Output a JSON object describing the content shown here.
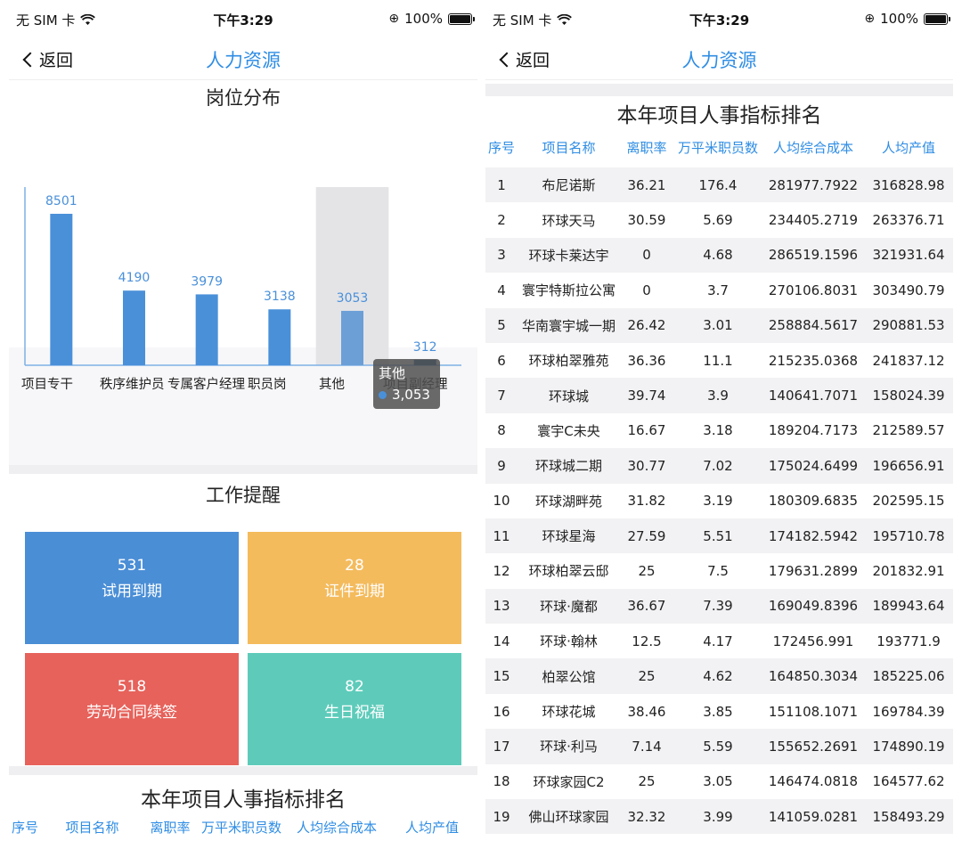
{
  "status_bar": {
    "carrier": "无 SIM 卡",
    "time": "下午3:29",
    "battery": "100%"
  },
  "nav": {
    "back_label": "返回",
    "title": "人力资源"
  },
  "chart_data": {
    "type": "bar",
    "title": "岗位分布",
    "categories": [
      "项目专干",
      "秩序维护员",
      "专属客户经理",
      "职员岗",
      "其他",
      "项目副经理"
    ],
    "values": [
      8501,
      4190,
      3979,
      3138,
      3053,
      312
    ],
    "highlighted_category": "其他",
    "tooltip": {
      "category": "其他",
      "value": "3,053"
    },
    "color": "#4a90d9",
    "highlight_color": "#e4e4e7"
  },
  "reminders": {
    "title": "工作提醒",
    "items": [
      {
        "count": "531",
        "label": "试用到期",
        "color": "#4a8ed6"
      },
      {
        "count": "28",
        "label": "证件到期",
        "color": "#f4bb5d"
      },
      {
        "count": "518",
        "label": "劳动合同续签",
        "color": "#e6625b"
      },
      {
        "count": "82",
        "label": "生日祝福",
        "color": "#5ecbba"
      }
    ]
  },
  "ranking": {
    "title": "本年项目人事指标排名",
    "headers": [
      "序号",
      "项目名称",
      "离职率",
      "万平米职员数",
      "人均综合成本",
      "人均产值"
    ],
    "rows": [
      [
        "1",
        "布尼诺斯",
        "36.21",
        "176.4",
        "281977.7922",
        "316828.98"
      ],
      [
        "2",
        "环球天马",
        "30.59",
        "5.69",
        "234405.2719",
        "263376.71"
      ],
      [
        "3",
        "环球卡莱达宇",
        "0",
        "4.68",
        "286519.1596",
        "321931.64"
      ],
      [
        "4",
        "寰宇特斯拉公寓",
        "0",
        "3.7",
        "270106.8031",
        "303490.79"
      ],
      [
        "5",
        "华南寰宇城一期",
        "26.42",
        "3.01",
        "258884.5617",
        "290881.53"
      ],
      [
        "6",
        "环球柏翠雅苑",
        "36.36",
        "11.1",
        "215235.0368",
        "241837.12"
      ],
      [
        "7",
        "环球城",
        "39.74",
        "3.9",
        "140641.7071",
        "158024.39"
      ],
      [
        "8",
        "寰宇C未央",
        "16.67",
        "3.18",
        "189204.7173",
        "212589.57"
      ],
      [
        "9",
        "环球城二期",
        "30.77",
        "7.02",
        "175024.6499",
        "196656.91"
      ],
      [
        "10",
        "环球湖畔苑",
        "31.82",
        "3.19",
        "180309.6835",
        "202595.15"
      ],
      [
        "11",
        "环球星海",
        "27.59",
        "5.51",
        "174182.5942",
        "195710.78"
      ],
      [
        "12",
        "环球柏翠云邸",
        "25",
        "7.5",
        "179631.2899",
        "201832.91"
      ],
      [
        "13",
        "环球·魔都",
        "36.67",
        "7.39",
        "169049.8396",
        "189943.64"
      ],
      [
        "14",
        "环球·翰林",
        "12.5",
        "4.17",
        "172456.991",
        "193771.9"
      ],
      [
        "15",
        "柏翠公馆",
        "25",
        "4.62",
        "164850.3034",
        "185225.06"
      ],
      [
        "16",
        "环球花城",
        "38.46",
        "3.85",
        "151108.1071",
        "169784.39"
      ],
      [
        "17",
        "环球·利马",
        "7.14",
        "5.59",
        "155652.2691",
        "174890.19"
      ],
      [
        "18",
        "环球家园C2",
        "25",
        "3.05",
        "146474.0818",
        "164577.62"
      ],
      [
        "19",
        "佛山环球家园",
        "32.32",
        "3.99",
        "141059.0281",
        "158493.29"
      ]
    ]
  }
}
